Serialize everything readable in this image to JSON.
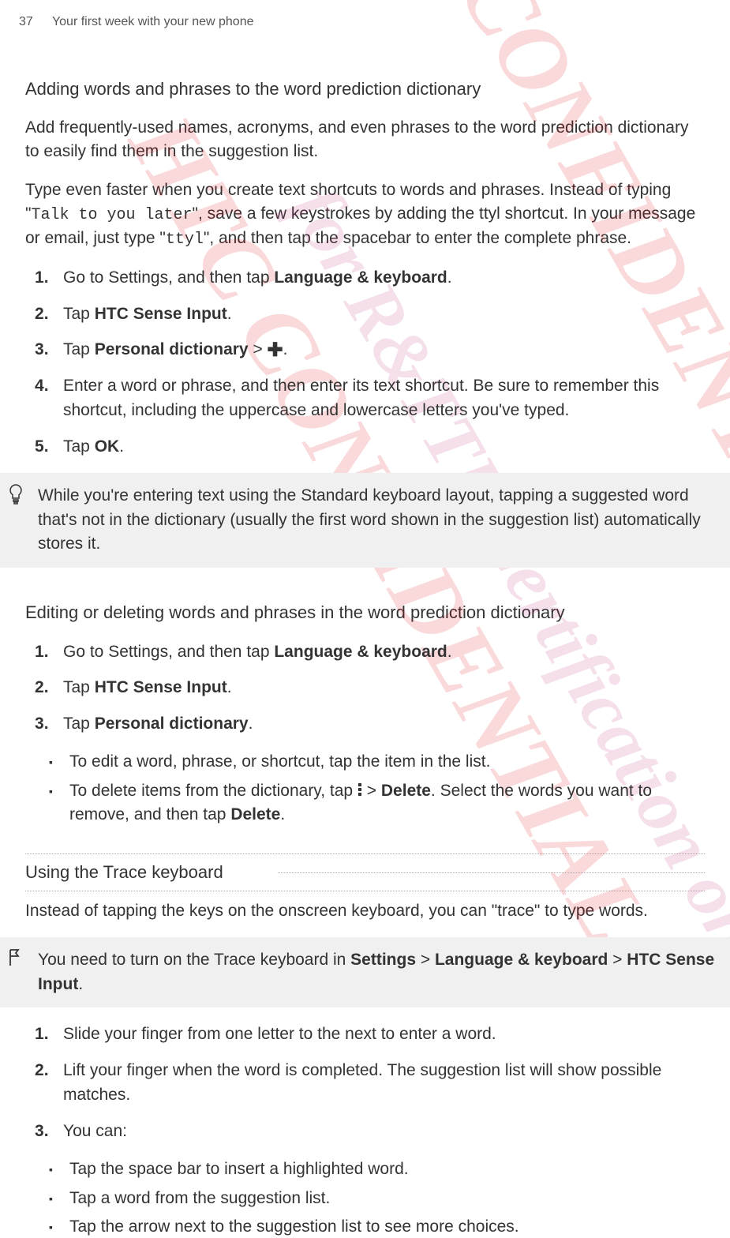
{
  "header": {
    "page_number": "37",
    "title": "Your first week with your new phone"
  },
  "watermarks": {
    "line1": "HTC CONFIDENTIAL",
    "line2": "for R&TTE Certification only",
    "line3": "HTC CONFIDENTIAL"
  },
  "section1": {
    "heading": "Adding words and phrases to the word prediction dictionary",
    "p1": "Add frequently-used names, acronyms, and even phrases to the word prediction dictionary to easily find them in the suggestion list.",
    "p2_pre": "Type even faster when you create text shortcuts to words and phrases. Instead of typing \"",
    "p2_code1": "Talk to you later",
    "p2_mid": "\", save a few keystrokes by adding the ttyl shortcut. In your message or email, just type \"",
    "p2_code2": "ttyl",
    "p2_post": "\", and then tap the spacebar to enter the complete phrase.",
    "steps": [
      {
        "pre": "Go to Settings, and then tap ",
        "b1": "Language & keyboard",
        "post": "."
      },
      {
        "pre": "Tap ",
        "b1": "HTC Sense Input",
        "post": "."
      },
      {
        "pre": "Tap ",
        "b1": "Personal dictionary",
        "mid": " > ",
        "icon": "plus",
        "post": "."
      },
      {
        "text": "Enter a word or phrase, and then enter its text shortcut. Be sure to remember this shortcut, including the uppercase and lowercase letters you've typed."
      },
      {
        "pre": "Tap ",
        "b1": "OK",
        "post": "."
      }
    ],
    "callout": "While you're entering text using the Standard keyboard layout, tapping a suggested word that's not in the dictionary (usually the first word shown in the suggestion list) automatically stores it."
  },
  "section2": {
    "heading": "Editing or deleting words and phrases in the word prediction dictionary",
    "steps": [
      {
        "pre": "Go to Settings, and then tap ",
        "b1": "Language & keyboard",
        "post": "."
      },
      {
        "pre": "Tap ",
        "b1": "HTC Sense Input",
        "post": "."
      },
      {
        "pre": "Tap ",
        "b1": "Personal dictionary",
        "post": "."
      }
    ],
    "bullets": [
      {
        "text": "To edit a word, phrase, or shortcut, tap the item in the list."
      },
      {
        "pre": "To delete items from the dictionary, tap ",
        "icon": "overflow",
        "mid": " > ",
        "b1": "Delete",
        "mid2": ". Select the words you want to remove, and then tap ",
        "b2": "Delete",
        "post": "."
      }
    ]
  },
  "section3": {
    "heading": "Using the Trace keyboard",
    "p1": "Instead of tapping the keys on the onscreen keyboard, you can \"trace\" to type words.",
    "callout_pre": "You need to turn on the Trace keyboard in ",
    "callout_b1": "Settings",
    "callout_s1": " > ",
    "callout_b2": "Language & keyboard",
    "callout_s2": " > ",
    "callout_b3": "HTC Sense Input",
    "callout_post": ".",
    "steps": [
      {
        "text": "Slide your finger from one letter to the next to enter a word."
      },
      {
        "text": "Lift your finger when the word is completed. The suggestion list will show possible matches."
      },
      {
        "text": "You can:"
      }
    ],
    "bullets": [
      {
        "text": "Tap the space bar to insert a highlighted word."
      },
      {
        "text": "Tap a word from the suggestion list."
      },
      {
        "text": "Tap the arrow next to the suggestion list to see more choices."
      }
    ]
  }
}
